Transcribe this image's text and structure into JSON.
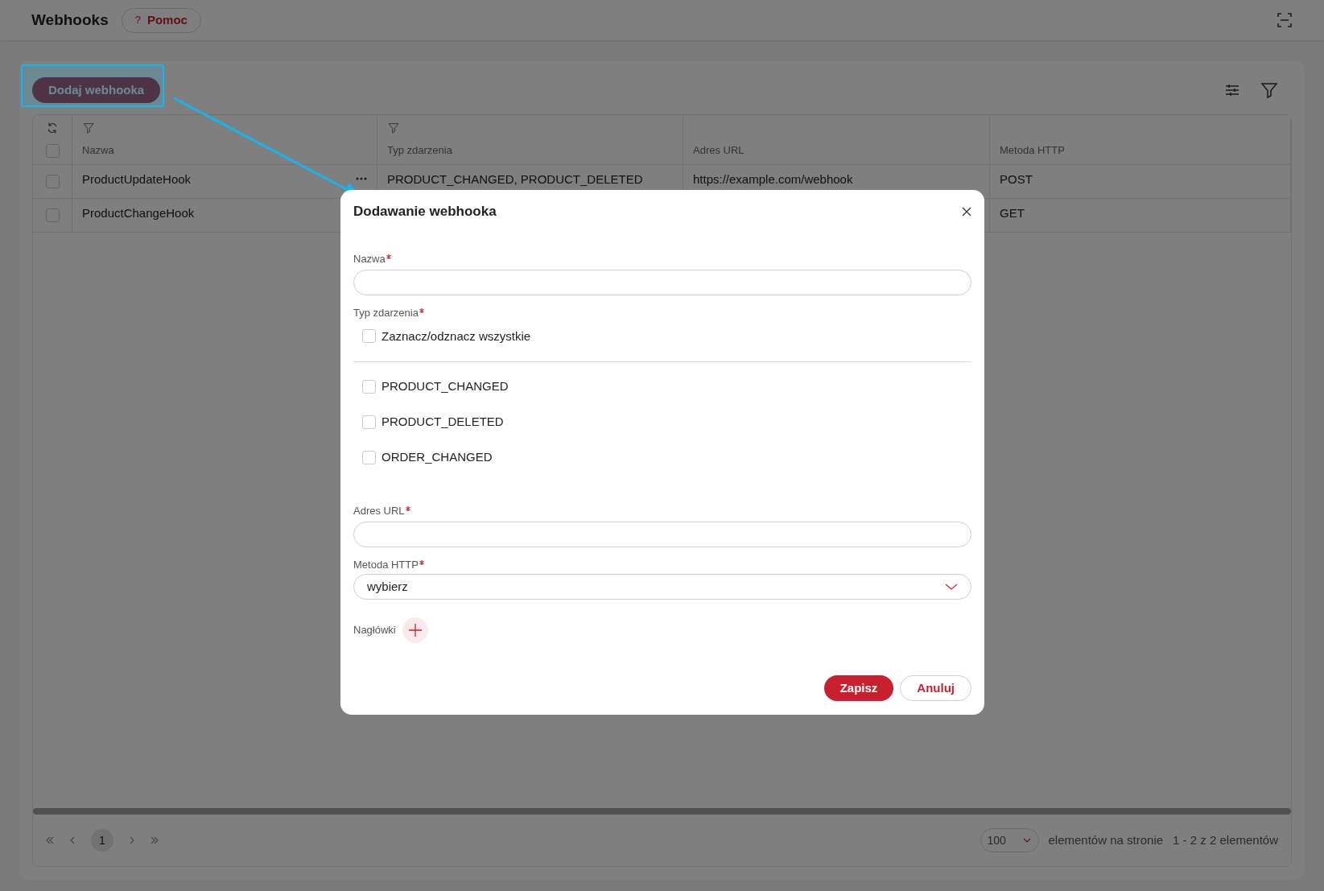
{
  "header": {
    "title": "Webhooks",
    "help_button": {
      "icon": "?",
      "label": "Pomoc"
    }
  },
  "toolbar": {
    "add_button": "Dodaj webhooka"
  },
  "table": {
    "select_all_checked": false,
    "columns": [
      {
        "label": "Nazwa",
        "filter": true
      },
      {
        "label": "Typ zdarzenia",
        "filter": true
      },
      {
        "label": "Adres URL",
        "filter": false
      },
      {
        "label": "Metoda HTTP",
        "filter": false
      }
    ],
    "rows": [
      {
        "checked": false,
        "cells": [
          "ProductUpdateHook",
          "PRODUCT_CHANGED, PRODUCT_DELETED",
          "https://example.com/webhook",
          "POST"
        ]
      },
      {
        "checked": false,
        "cells": [
          "ProductChangeHook",
          "",
          "",
          "GET"
        ]
      }
    ]
  },
  "pagination": {
    "pages": [
      {
        "label": "1",
        "selected": true
      }
    ],
    "page_size": "100",
    "page_size_label": "elementów na stronie",
    "summary": "1 - 2 z 2 elementów"
  },
  "dialog": {
    "title": "Dodawanie webhooka",
    "name_field": {
      "label": "Nazwa",
      "required": true
    },
    "event_type": {
      "label": "Typ zdarzenia",
      "required": true,
      "select_all": {
        "label": "Zaznacz/odznacz wszystkie",
        "checked": false
      },
      "options": [
        {
          "label": "PRODUCT_CHANGED",
          "checked": false
        },
        {
          "label": "PRODUCT_DELETED",
          "checked": false
        },
        {
          "label": "ORDER_CHANGED",
          "checked": false
        }
      ]
    },
    "url_field": {
      "label": "Adres URL",
      "required": true
    },
    "method_field": {
      "label": "Metoda HTTP",
      "required": true,
      "value": "wybierz"
    },
    "headers": {
      "label": "Nagłówki"
    },
    "buttons": [
      {
        "label": "Zapisz",
        "kind": "primary"
      },
      {
        "label": "Anuluj",
        "kind": "secondary"
      }
    ]
  }
}
